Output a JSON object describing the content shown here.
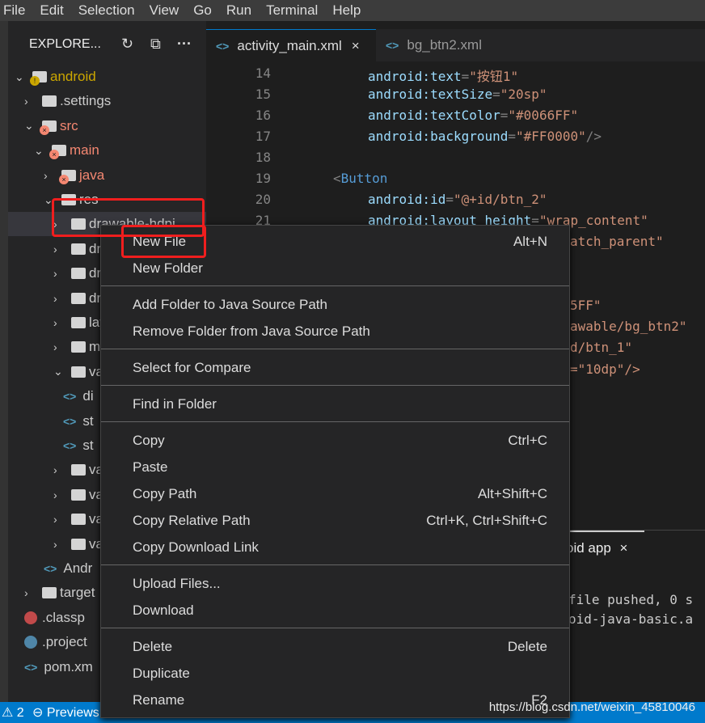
{
  "menubar": [
    "File",
    "Edit",
    "Selection",
    "View",
    "Go",
    "Run",
    "Terminal",
    "Help"
  ],
  "explorer": {
    "title": "EXPLORE...",
    "icons": [
      "refresh-icon",
      "collapse-all-icon",
      "more-icon"
    ]
  },
  "tree": [
    {
      "label": "android",
      "depth": 0,
      "type": "folder",
      "open": true,
      "color": "#cca700",
      "badge": "warning"
    },
    {
      "label": ".settings",
      "depth": 1,
      "type": "folder",
      "open": false,
      "color": "#cccccc"
    },
    {
      "label": "src",
      "depth": 1,
      "type": "folder",
      "open": true,
      "color": "#f48771",
      "badge": "error"
    },
    {
      "label": "main",
      "depth": 2,
      "type": "folder",
      "open": true,
      "color": "#f48771",
      "badge": "error"
    },
    {
      "label": "java",
      "depth": 3,
      "type": "folder",
      "open": false,
      "color": "#f48771",
      "badge": "error"
    },
    {
      "label": "res",
      "depth": 3,
      "type": "folder",
      "open": true,
      "color": "#cccccc"
    },
    {
      "label": "drawable-hdpi",
      "depth": 4,
      "type": "folder",
      "open": false,
      "color": "#cccccc",
      "selected": true
    },
    {
      "label": "dra",
      "depth": 4,
      "type": "folder",
      "open": false,
      "color": "#cccccc"
    },
    {
      "label": "dra",
      "depth": 4,
      "type": "folder",
      "open": false,
      "color": "#cccccc"
    },
    {
      "label": "dra",
      "depth": 4,
      "type": "folder",
      "open": false,
      "color": "#cccccc"
    },
    {
      "label": "lay",
      "depth": 4,
      "type": "folder",
      "open": false,
      "color": "#cccccc"
    },
    {
      "label": "me",
      "depth": 4,
      "type": "folder",
      "open": false,
      "color": "#cccccc"
    },
    {
      "label": "va",
      "depth": 4,
      "type": "folder",
      "open": true,
      "color": "#cccccc"
    },
    {
      "label": "di",
      "depth": 5,
      "type": "xml",
      "color": "#cccccc"
    },
    {
      "label": "st",
      "depth": 5,
      "type": "xml",
      "color": "#cccccc"
    },
    {
      "label": "st",
      "depth": 5,
      "type": "xml",
      "color": "#cccccc"
    },
    {
      "label": "va",
      "depth": 4,
      "type": "folder",
      "open": false,
      "color": "#cccccc"
    },
    {
      "label": "va",
      "depth": 4,
      "type": "folder",
      "open": false,
      "color": "#cccccc"
    },
    {
      "label": "va",
      "depth": 4,
      "type": "folder",
      "open": false,
      "color": "#cccccc"
    },
    {
      "label": "va",
      "depth": 4,
      "type": "folder",
      "open": false,
      "color": "#cccccc"
    },
    {
      "label": "Andr",
      "depth": 3,
      "type": "xml",
      "color": "#cccccc"
    },
    {
      "label": "target",
      "depth": 1,
      "type": "folder",
      "open": false,
      "color": "#cccccc"
    },
    {
      "label": ".classp",
      "depth": 1,
      "type": "eclipse-red",
      "color": "#cccccc"
    },
    {
      "label": ".project",
      "depth": 1,
      "type": "eclipse-blue",
      "color": "#cccccc"
    },
    {
      "label": "pom.xm",
      "depth": 1,
      "type": "xml",
      "color": "#cccccc"
    }
  ],
  "tabs": [
    {
      "label": "activity_main.xml",
      "active": true,
      "close": "×"
    },
    {
      "label": "bg_btn2.xml",
      "active": false
    }
  ],
  "code": {
    "line_numbers": [
      "14",
      "15",
      "16",
      "17",
      "18",
      "19",
      "20",
      "21"
    ],
    "lines": [
      [
        {
          "t": "android:text",
          "c": "attr"
        },
        {
          "t": "=",
          "c": "pun"
        },
        {
          "t": "\"按钮1\"",
          "c": "str"
        }
      ],
      [
        {
          "t": "android:textSize",
          "c": "attr"
        },
        {
          "t": "=",
          "c": "pun"
        },
        {
          "t": "\"20sp\"",
          "c": "str"
        }
      ],
      [
        {
          "t": "android:textColor",
          "c": "attr"
        },
        {
          "t": "=",
          "c": "pun"
        },
        {
          "t": "\"#0066FF\"",
          "c": "str"
        }
      ],
      [
        {
          "t": "android:background",
          "c": "attr"
        },
        {
          "t": "=",
          "c": "pun"
        },
        {
          "t": "\"#FF0000\"",
          "c": "str"
        },
        {
          "t": "/>",
          "c": "pun"
        }
      ],
      [],
      [
        {
          "t": "<",
          "c": "pun"
        },
        {
          "t": "Button",
          "c": "tag"
        }
      ],
      [
        {
          "t": "android:id",
          "c": "attr"
        },
        {
          "t": "=",
          "c": "pun"
        },
        {
          "t": "\"@+id/btn_2\"",
          "c": "str"
        }
      ],
      [
        {
          "t": "android:layout_height",
          "c": "attr"
        },
        {
          "t": "=",
          "c": "pun"
        },
        {
          "t": "\"wrap_content\"",
          "c": "str"
        }
      ]
    ],
    "fragments": [
      "atch_parent\"",
      "5FF\"",
      "awable/bg_btn2\"",
      "d/btn_1\"",
      "=\"10dp\"/>"
    ]
  },
  "panel": {
    "tab": "oid app",
    "close": "×",
    "output": [
      "file pushed, 0 s",
      "oid-java-basic.a"
    ]
  },
  "context_menu": [
    [
      {
        "label": "New File",
        "shortcut": "Alt+N"
      },
      {
        "label": "New Folder",
        "shortcut": ""
      }
    ],
    [
      {
        "label": "Add Folder to Java Source Path",
        "shortcut": ""
      },
      {
        "label": "Remove Folder from Java Source Path",
        "shortcut": ""
      }
    ],
    [
      {
        "label": "Select for Compare",
        "shortcut": ""
      }
    ],
    [
      {
        "label": "Find in Folder",
        "shortcut": ""
      }
    ],
    [
      {
        "label": "Copy",
        "shortcut": "Ctrl+C"
      },
      {
        "label": "Paste",
        "shortcut": ""
      },
      {
        "label": "Copy Path",
        "shortcut": "Alt+Shift+C"
      },
      {
        "label": "Copy Relative Path",
        "shortcut": "Ctrl+K, Ctrl+Shift+C"
      },
      {
        "label": "Copy Download Link",
        "shortcut": ""
      }
    ],
    [
      {
        "label": "Upload Files...",
        "shortcut": ""
      },
      {
        "label": "Download",
        "shortcut": ""
      }
    ],
    [
      {
        "label": "Delete",
        "shortcut": "Delete"
      },
      {
        "label": "Duplicate",
        "shortcut": ""
      },
      {
        "label": "Rename",
        "shortcut": "F2"
      }
    ]
  ],
  "status": {
    "warnings": "2",
    "previews": "Previews"
  },
  "watermark": "https://blog.csdn.net/weixin_45810046",
  "colors": {
    "accent": "#007acc",
    "highlight_box": "#f01e1e"
  }
}
